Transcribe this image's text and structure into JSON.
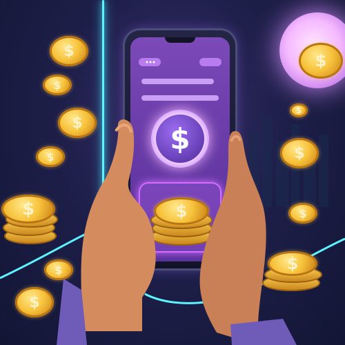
{
  "scene": {
    "description_hidden": "",
    "coin_symbol": "$",
    "colors": {
      "neon_cyan": "#5ff3ff",
      "coin_gold": "#f7c23b",
      "screen_purple": "#6a3ca8",
      "glow_pink": "#d46dff"
    }
  },
  "icons": {
    "dollar": "dollar-icon"
  }
}
